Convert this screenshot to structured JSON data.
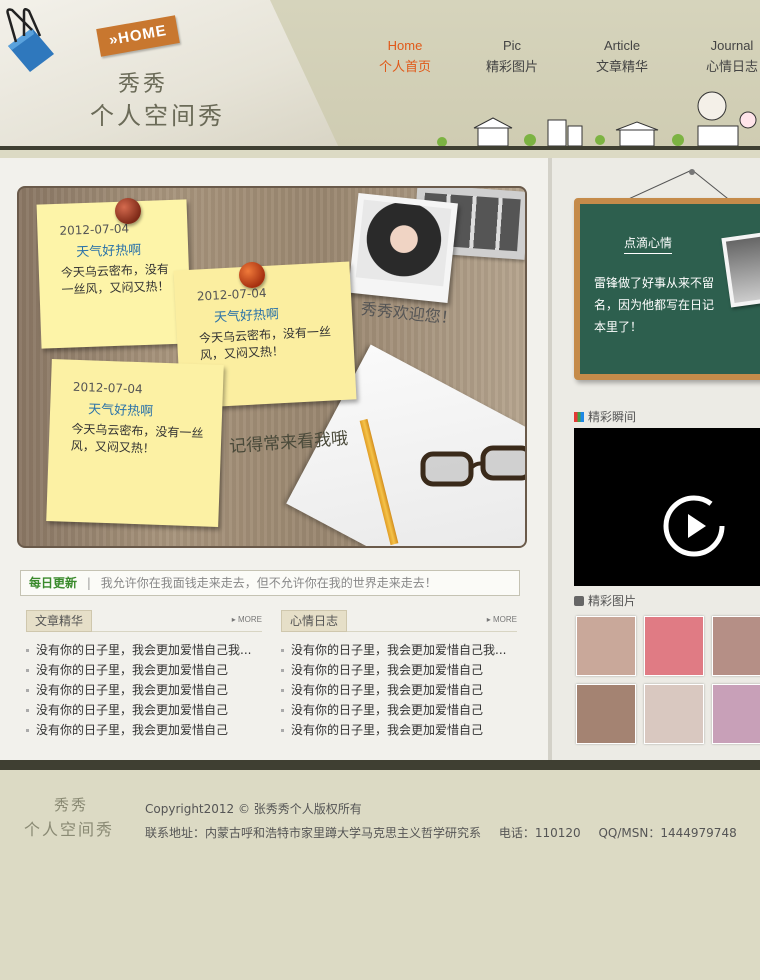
{
  "header": {
    "home_tag": "»HOME",
    "site_name_line1": "秀秀",
    "site_name_line2": "个人空间秀",
    "nav": [
      {
        "en": "Home",
        "cn": "个人首页",
        "active": true
      },
      {
        "en": "Pic",
        "cn": "精彩图片",
        "active": false
      },
      {
        "en": "Article",
        "cn": "文章精华",
        "active": false
      },
      {
        "en": "Journal",
        "cn": "心情日志",
        "active": false
      }
    ]
  },
  "hero": {
    "notes": [
      {
        "date": "2012-07-04",
        "title": "天气好热啊",
        "body": "今天乌云密布，没有一丝风，又闷又热！"
      },
      {
        "date": "2012-07-04",
        "title": "天气好热啊",
        "body": "今天乌云密布，没有一丝风，又闷又热！"
      },
      {
        "date": "2012-07-04",
        "title": "天气好热啊",
        "body": "今天乌云密布，没有一丝风，又闷又热！"
      }
    ],
    "welcome": "秀秀欢迎您！",
    "remember": "记得常来看我哦"
  },
  "daily": {
    "label": "每日更新",
    "separator": "|",
    "text": "我允许你在我面钱走来走去，但不允许你在我的世界走来走去！"
  },
  "lists": {
    "left": {
      "title": "文章精华",
      "more": "MORE",
      "items": [
        "没有你的日子里，我会更加爱惜自己我...",
        "没有你的日子里，我会更加爱惜自己",
        "没有你的日子里，我会更加爱惜自己",
        "没有你的日子里，我会更加爱惜自己",
        "没有你的日子里，我会更加爱惜自己"
      ]
    },
    "right": {
      "title": "心情日志",
      "more": "MORE",
      "items": [
        "没有你的日子里，我会更加爱惜自己我...",
        "没有你的日子里，我会更加爱惜自己",
        "没有你的日子里，我会更加爱惜自己",
        "没有你的日子里，我会更加爱惜自己",
        "没有你的日子里，我会更加爱惜自己"
      ]
    }
  },
  "sidebar": {
    "mood_title": "点滴心情",
    "mood_text": "雷锋做了好事从来不留名，因为他都写在日记本里了！",
    "video_label": "精彩瞬间",
    "photos_label": "精彩图片",
    "photo_colors": [
      "#c9a89a",
      "#e07b84",
      "#b58f86",
      "#a48372",
      "#d9c8c0",
      "#c8a0b8"
    ]
  },
  "footer": {
    "logo_line1": "秀秀",
    "logo_line2": "个人空间秀",
    "copyright": "Copyright2012 © 张秀秀个人版权所有",
    "address": "联系地址：内蒙古呼和浩特市家里蹲大学马克思主义哲学研究系",
    "phone": "电话：110120",
    "qq": "QQ/MSN：1444979748"
  }
}
